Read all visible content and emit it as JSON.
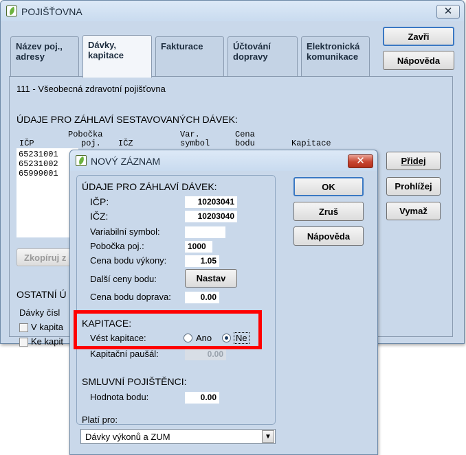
{
  "main_window": {
    "title": "POJIŠŤOVNA",
    "close_glyph": "✕",
    "icon": "app-leaf-icon",
    "tabs": [
      {
        "label": "Název poj., adresy"
      },
      {
        "label": "Dávky, kapitace",
        "active": true
      },
      {
        "label": "Fakturace"
      },
      {
        "label": "Účtování dopravy"
      },
      {
        "label": "Elektronická komunikace"
      }
    ],
    "buttons": {
      "close": "Zavři",
      "help": "Nápověda",
      "add": "Přidej",
      "browse": "Prohlížej",
      "delete": "Vymaž",
      "copy": "Zkopíruj z"
    },
    "insurer": "111 - Všeobecná zdravotní pojišťovna",
    "batch_header_title": "ÚDAJE PRO ZÁHLAVÍ SESTAVOVANÝCH DÁVEK:",
    "columns": {
      "icp": "IČP",
      "branch_1": "Pobočka",
      "branch_2": "poj.",
      "icz": "IČZ",
      "var_1": "Var.",
      "var_2": "symbol",
      "price_1": "Cena",
      "price_2": "bodu",
      "capitation": "Kapitace"
    },
    "rows": [
      "65231001",
      "65231002",
      "65999001"
    ],
    "other_title": "OSTATNÍ Ú",
    "batch_numbers_label": "Dávky čísl",
    "checkbox_1": "V kapita",
    "checkbox_2": "Ke kapit"
  },
  "dialog": {
    "title": "NOVÝ ZÁZNAM",
    "close_glyph": "✕",
    "section_header": "ÚDAJE PRO ZÁHLAVÍ DÁVEK:",
    "icp_label": "IČP:",
    "icp_value": "10203041",
    "icz_label": "IČZ:",
    "icz_value": "10203040",
    "var_symbol_label": "Variabilní symbol:",
    "var_symbol_value": "",
    "branch_label": "Pobočka poj.:",
    "branch_value": "1000",
    "price_label": "Cena bodu výkony:",
    "price_value": "1.05",
    "other_prices_label": "Další ceny bodu:",
    "set_button": "Nastav",
    "transport_price_label": "Cena bodu doprava:",
    "transport_price_value": "0.00",
    "capitation_header": "KAPITACE:",
    "keep_capitation_label": "Vést kapitace:",
    "radio_yes": "Ano",
    "radio_no": "Ne",
    "radio_selected": "Ne",
    "capitation_fee_label": "Kapitační paušál:",
    "capitation_fee_value": "0.00",
    "contract_header": "SMLUVNÍ POJIŠTĚNCI:",
    "point_value_label": "Hodnota bodu:",
    "point_value": "0.00",
    "valid_for_label": "Platí pro:",
    "valid_for_value": "Dávky výkonů a ZUM",
    "ok": "OK",
    "cancel": "Zruš",
    "help": "Nápověda"
  },
  "colors": {
    "highlight": "#ff0000",
    "panel": "#c9d8ea"
  }
}
